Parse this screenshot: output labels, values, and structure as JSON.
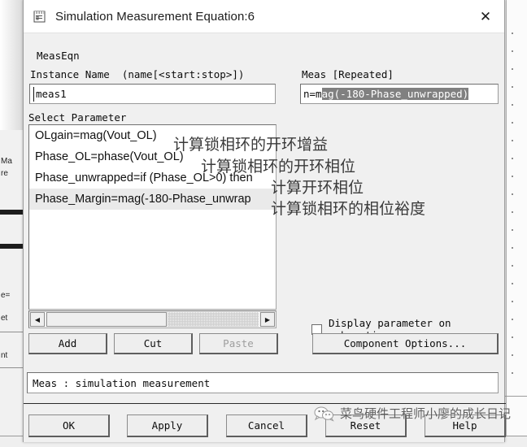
{
  "window": {
    "title": "Simulation Measurement Equation:6",
    "icon": "document-equation-icon",
    "close_label": "✕"
  },
  "form": {
    "group_label": "MeasEqn",
    "instance_label": "Instance Name  (name[<start:stop>])",
    "instance_value": "meas1",
    "select_parameter_label": "Select Parameter",
    "meas_label": "Meas [Repeated]",
    "meas_value_prefix": "n=m",
    "meas_value_selected": "ag(-180-Phase_unwrapped)"
  },
  "parameters": [
    {
      "text": "OLgain=mag(Vout_OL)",
      "selected": false
    },
    {
      "text": "Phase_OL=phase(Vout_OL)",
      "selected": false
    },
    {
      "text": "Phase_unwrapped=if (Phase_OL>0) then",
      "selected": false
    },
    {
      "text": "Phase_Margin=mag(-180-Phase_unwrap",
      "selected": true
    }
  ],
  "scrollbar": {
    "left_arrow": "◀",
    "right_arrow": "▶"
  },
  "buttons": {
    "add": "Add",
    "cut": "Cut",
    "paste": "Paste",
    "component_options": "Component Options...",
    "ok": "OK",
    "apply": "Apply",
    "cancel": "Cancel",
    "reset": "Reset",
    "help": "Help"
  },
  "checkbox": {
    "label": "Display parameter on schematic",
    "checked": false
  },
  "status": {
    "text": "Meas : simulation measurement"
  },
  "annotations": [
    "计算锁相环的开环增益",
    "计算锁相环的开环相位",
    "计算开环相位",
    "计算锁相环的相位裕度"
  ],
  "watermark": {
    "text": "菜鸟硬件工程师小廖的成长日记",
    "icon": "wechat-icon"
  },
  "background": {
    "left_fragments": [
      "Ma",
      "re",
      "e=",
      "et",
      "nt"
    ]
  },
  "colors": {
    "dialog_bg": "#f0f0f0",
    "field_bg": "#ffffff",
    "selection": "#808080",
    "list_selection": "#eaeaea",
    "border": "#9a9a9a"
  }
}
